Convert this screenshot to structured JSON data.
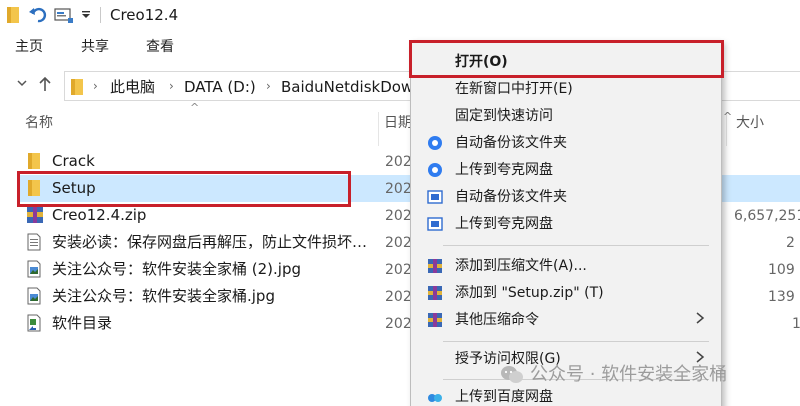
{
  "window": {
    "title": "Creo12.4"
  },
  "ribbon": {
    "tabs": [
      "主页",
      "共享",
      "查看"
    ]
  },
  "address": {
    "crumbs": [
      "此电脑",
      "DATA (D:)",
      "BaiduNetdiskDow"
    ]
  },
  "columns": {
    "name": "名称",
    "date": "日期",
    "size": "大小"
  },
  "files": [
    {
      "name": "Crack",
      "date": "202",
      "size": "",
      "icon": "folder-icon",
      "selected": false
    },
    {
      "name": "Setup",
      "date": "202",
      "size": "",
      "icon": "folder-icon",
      "selected": true
    },
    {
      "name": "Creo12.4.zip",
      "date": "202",
      "size": "6,657,251",
      "icon": "zip-archive-icon",
      "selected": false
    },
    {
      "name": "安装必读：保存网盘后再解压，防止文件损坏…",
      "date": "202",
      "size": "2",
      "icon": "text-document-icon",
      "selected": false
    },
    {
      "name": "关注公众号：软件安装全家桶 (2).jpg",
      "date": "202",
      "size": "109",
      "icon": "image-file-icon",
      "selected": false
    },
    {
      "name": "关注公众号：软件安装全家桶.jpg",
      "date": "202",
      "size": "139",
      "icon": "image-file-icon",
      "selected": false
    },
    {
      "name": "软件目录",
      "date": "202",
      "size": "1",
      "icon": "shortcut-icon",
      "selected": false
    }
  ],
  "context_menu": {
    "items": [
      {
        "label": "打开(O)",
        "bold": true,
        "icon": ""
      },
      {
        "label": "在新窗口中打开(E)",
        "icon": ""
      },
      {
        "label": "固定到快速访问",
        "icon": ""
      },
      {
        "label": "自动备份该文件夹",
        "icon": "quark-backup-icon"
      },
      {
        "label": "上传到夸克网盘",
        "icon": "quark-upload-icon"
      },
      {
        "label": "自动备份该文件夹",
        "icon": "baidu-backup-icon"
      },
      {
        "label": "上传到夸克网盘",
        "icon": "baidu-upload-icon"
      },
      {
        "label": "添加到压缩文件(A)...",
        "icon": "winrar-icon"
      },
      {
        "label": "添加到 \"Setup.zip\" (T)",
        "icon": "winrar-icon"
      },
      {
        "label": "其他压缩命令",
        "icon": "winrar-icon",
        "submenu": true
      },
      {
        "label": "授予访问权限(G)",
        "icon": "",
        "submenu": true
      },
      {
        "label": "上传到百度网盘",
        "icon": "baidu-netdisk-icon"
      }
    ]
  },
  "watermark": {
    "text": "公众号 · 软件安装全家桶"
  },
  "colors": {
    "highlight_box": "#c8202a",
    "selection": "#cce8ff",
    "folder": "#f3c54b"
  }
}
